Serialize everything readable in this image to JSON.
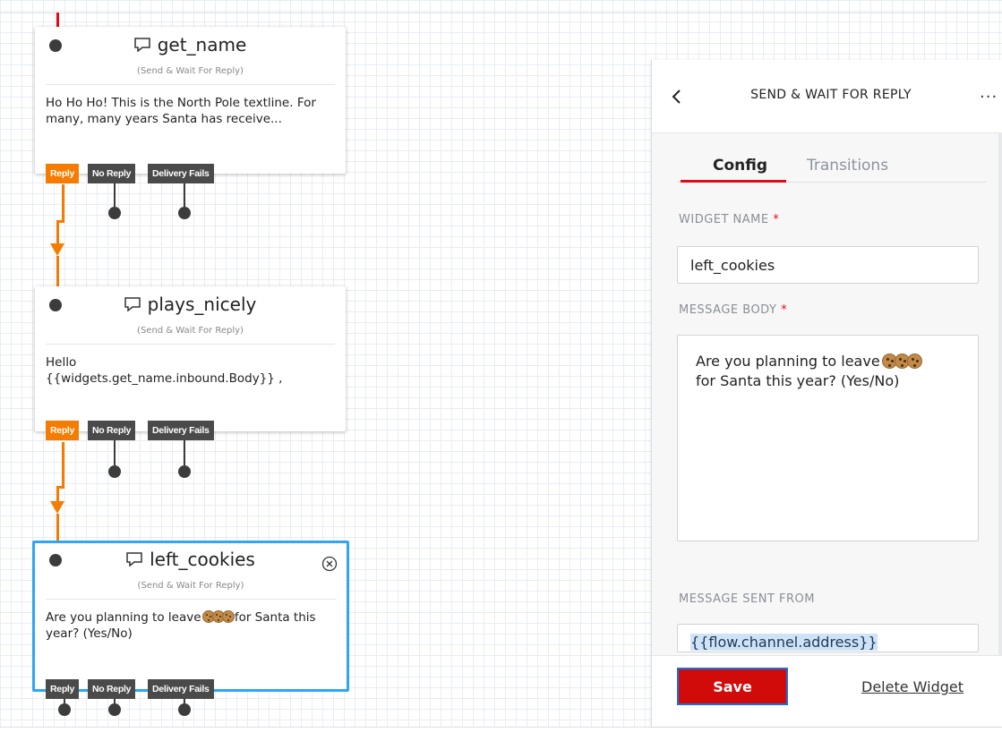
{
  "widgets": [
    {
      "name": "get_name",
      "subtitle": "(Send & Wait For Reply)",
      "body": "Ho Ho Ho! This is the North Pole textline. For many, many years Santa has receive...",
      "tags": [
        "Reply",
        "No Reply",
        "Delivery Fails"
      ]
    },
    {
      "name": "plays_nicely",
      "subtitle": "(Send & Wait For Reply)",
      "body_line1": "Hello",
      "body_line2": "{{widgets.get_name.inbound.Body}} ,",
      "tags": [
        "Reply",
        "No Reply",
        "Delivery Fails"
      ]
    },
    {
      "name": "left_cookies",
      "subtitle": "(Send & Wait For Reply)",
      "body_pre": "Are you planning to leave ",
      "body_post": "for Santa this year? (Yes/No)",
      "tags": [
        "Reply",
        "No Reply",
        "Delivery Fails"
      ],
      "selected": true
    }
  ],
  "panel": {
    "title": "SEND & WAIT FOR REPLY",
    "more": "...",
    "tabs": [
      "Config",
      "Transitions"
    ],
    "active_tab": "Config",
    "widget_name_label": "WIDGET NAME",
    "required_mark": "*",
    "widget_name_value": "left_cookies",
    "message_body_label": "MESSAGE BODY",
    "message_body_pre": "Are you planning to leave ",
    "message_body_post": "for Santa this year? (Yes/No)",
    "message_sent_from_label": "MESSAGE SENT FROM",
    "message_sent_from_value": "{{flow.channel.address}}",
    "save_label": "Save",
    "delete_label": "Delete Widget"
  },
  "colors": {
    "accent_red": "#e30917",
    "wire_orange": "#f57c00",
    "selected_blue": "#2ea6f5",
    "save_red": "#d10a0a"
  },
  "icons": [
    "chat-bubble-icon",
    "close-circle-icon",
    "chevron-left-icon",
    "cookie-emoji-icon"
  ]
}
